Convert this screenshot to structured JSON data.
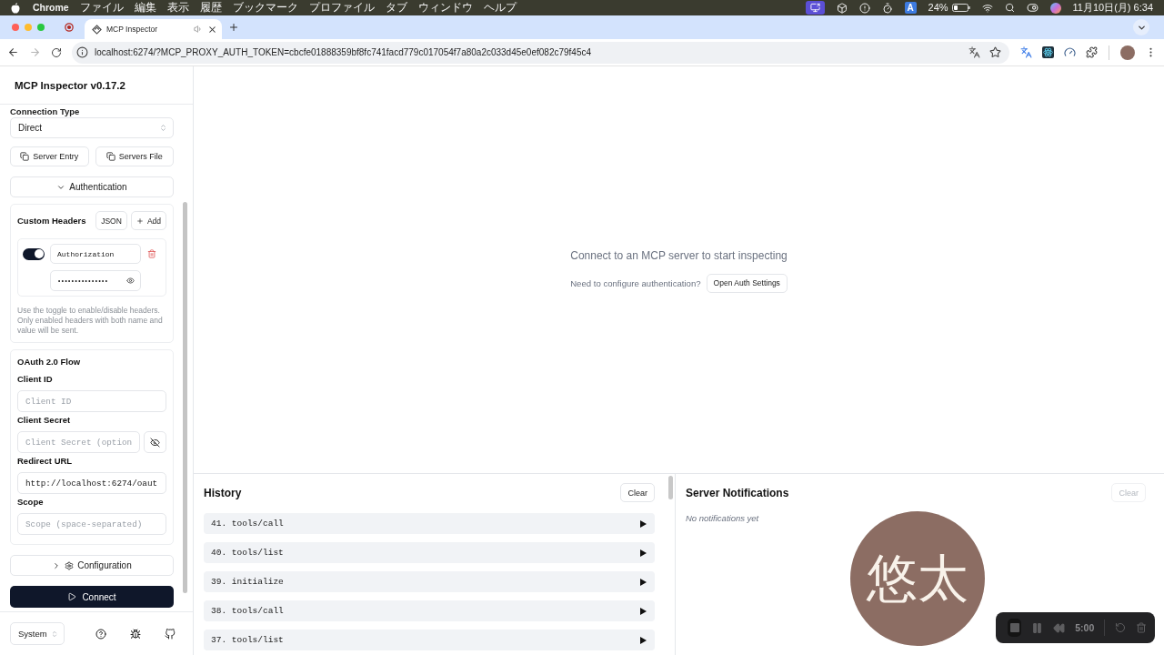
{
  "menu_bar": {
    "app": "Chrome",
    "menus": [
      "ファイル",
      "編集",
      "表示",
      "履歴",
      "ブックマーク",
      "プロファイル",
      "タブ",
      "ウィンドウ",
      "ヘルプ"
    ],
    "input_source": "A",
    "battery": "24%",
    "clock": "11月10日(月) 6:34"
  },
  "browser": {
    "tabs": [
      {
        "title": "MCP Inspector",
        "selected": true,
        "audio": true
      }
    ],
    "url": "localhost:6274/?MCP_PROXY_AUTH_TOKEN=cbcfe01888359bf8fc741facd779c017054f7a80a2c033d45e0ef082c79f45c4"
  },
  "sidebar": {
    "title": "MCP Inspector v0.17.2",
    "connection_type": {
      "label": "Connection Type",
      "value": "Direct"
    },
    "entry_buttons": [
      "Server Entry",
      "Servers File"
    ],
    "authentication": {
      "label": "Authentication",
      "expanded": true
    },
    "custom_headers": {
      "title": "Custom Headers",
      "json_button": "JSON",
      "add_button": "Add",
      "headers": [
        {
          "enabled": true,
          "name": "Authorization",
          "value": "•••••••••••••••"
        }
      ],
      "help": "Use the toggle to enable/disable headers. Only enabled headers with both name and value will be sent."
    },
    "oauth": {
      "title": "OAuth 2.0 Flow",
      "fields": [
        {
          "kind": "text",
          "label": "Client ID",
          "placeholder": "Client ID"
        },
        {
          "kind": "secret",
          "label": "Client Secret",
          "placeholder": "Client Secret (option",
          "revealed": false
        },
        {
          "kind": "text",
          "label": "Redirect URL",
          "value": "http://localhost:6274/oaut"
        },
        {
          "kind": "text",
          "label": "Scope",
          "placeholder": "Scope (space-separated)"
        }
      ]
    },
    "configuration": {
      "label": "Configuration",
      "expanded": false
    },
    "connect_button": "Connect",
    "theme_select": "System"
  },
  "main": {
    "message": "Connect to an MCP server to start inspecting",
    "auth_prompt": "Need to configure authentication?",
    "auth_button": "Open Auth Settings"
  },
  "history": {
    "title": "History",
    "clear_button": "Clear",
    "items": [
      {
        "label": "41. tools/call",
        "expanded": false
      },
      {
        "label": "40. tools/list",
        "expanded": false
      },
      {
        "label": "39. initialize",
        "expanded": false
      },
      {
        "label": "38. tools/call",
        "expanded": false
      },
      {
        "label": "37. tools/list",
        "expanded": false
      }
    ]
  },
  "notifications": {
    "title": "Server Notifications",
    "clear_button": {
      "label": "Clear",
      "disabled": true
    },
    "empty_text": "No notifications yet"
  },
  "recorder": {
    "avatar_text": "悠太",
    "timer": "5:00"
  }
}
